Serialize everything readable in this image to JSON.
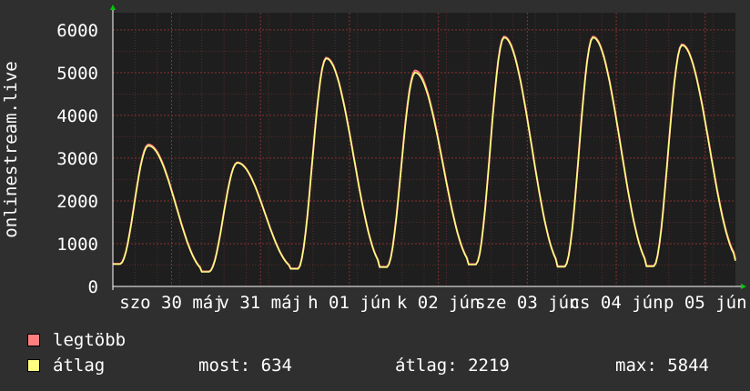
{
  "chart_data": {
    "type": "line",
    "ylabel": "onlinestream.live",
    "ylim": [
      0,
      6400
    ],
    "y_ticks": [
      0,
      1000,
      2000,
      3000,
      4000,
      5000,
      6000
    ],
    "x_tick_labels": [
      "szo 30 máj",
      "v 31 máj",
      "h 01 jún",
      "k 02 jún",
      "sze 03 jún",
      "cs 04 jún",
      "p 05 jún"
    ],
    "grid": true,
    "series": [
      {
        "name": "legtöbb",
        "color": "#ff7f7f",
        "peaks": [
          3320,
          2900,
          5350,
          5050,
          5844,
          5844,
          5660
        ],
        "troughs": [
          530,
          350,
          420,
          460,
          520,
          470,
          480,
          634
        ]
      },
      {
        "name": "átlag",
        "color": "#ffff80",
        "peaks": [
          3290,
          2890,
          5330,
          5000,
          5820,
          5820,
          5640
        ],
        "troughs": [
          520,
          340,
          410,
          450,
          510,
          460,
          470,
          600
        ]
      }
    ]
  },
  "legend": {
    "max_label": "legtöbb",
    "avg_label": "átlag"
  },
  "stats": {
    "now": "most: 634",
    "avg": "átlag: 2219",
    "max": "max: 5844"
  },
  "colors": {
    "background": "#2f2f2f",
    "plot_background": "#1e1e1e",
    "grid": "#5a2a2a",
    "axis": "#ffffff",
    "arrow": "#00cc00"
  }
}
